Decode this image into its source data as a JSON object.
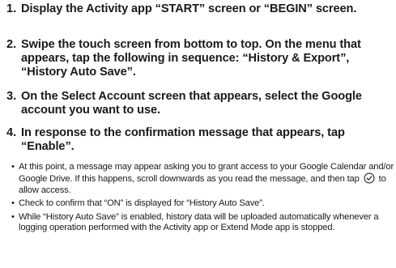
{
  "steps": [
    {
      "number": "1.",
      "text": "Display the Activity app “START” screen or “BEGIN” screen."
    },
    {
      "number": "2.",
      "text": "Swipe the touch screen from bottom to top. On the menu that appears, tap the following in sequence: “History & Export”, “History Auto Save”."
    },
    {
      "number": "3.",
      "text": "On the Select Account screen that appears, select the Google account you want to use."
    },
    {
      "number": "4.",
      "text": "In response to the confirmation message that appears, tap “Enable”."
    }
  ],
  "notes": [
    {
      "bullet": "•",
      "text_before_icon": "At this point, a message may appear asking you to grant access to your Google Calendar and/or Google Drive. If this happens, scroll downwards as you read the message, and then tap",
      "icon": "check-circle-icon",
      "text_after_icon": "to allow access."
    },
    {
      "bullet": "•",
      "text": "Check to confirm that “ON” is displayed for “History Auto Save”."
    },
    {
      "bullet": "•",
      "text": "While “History Auto Save” is enabled, history data will be uploaded automatically whenever a logging operation performed with the Activity app or Extend Mode app is stopped."
    }
  ],
  "colors": {
    "text": "#1a1a1a",
    "background": "#ffffff"
  }
}
